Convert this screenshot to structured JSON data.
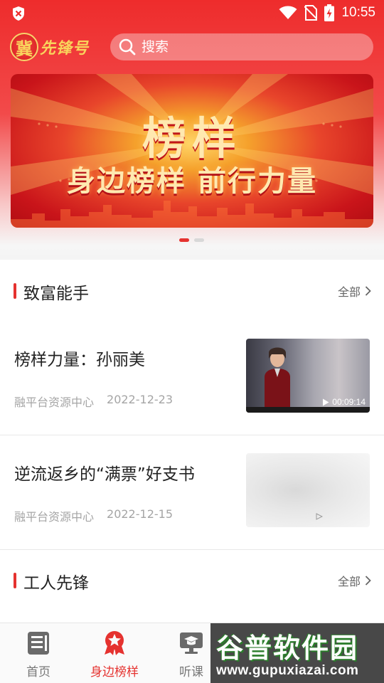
{
  "status_bar": {
    "time": "10:55",
    "icons": [
      "shield-icon",
      "wifi-icon",
      "no-sim-icon",
      "battery-charging-icon"
    ]
  },
  "header": {
    "logo_char": "冀",
    "logo_text": "先锋号",
    "search_placeholder": "搜索"
  },
  "banner": {
    "title": "榜样",
    "subtitle": "身边榜样 前行力量",
    "page_count": 2,
    "active_page": 1
  },
  "sections": [
    {
      "title": "致富能手",
      "more_label": "全部",
      "items": [
        {
          "title": "榜样力量：孙丽美",
          "source": "融平台资源中心",
          "date": "2022-12-23",
          "duration": "00:09:14"
        },
        {
          "title": "逆流返乡的“满票”好支书",
          "source": "融平台资源中心",
          "date": "2022-12-15"
        }
      ]
    },
    {
      "title": "工人先锋",
      "more_label": "全部"
    }
  ],
  "bottom_nav": [
    {
      "label": "首页",
      "icon": "document-icon",
      "active": false
    },
    {
      "label": "身边榜样",
      "icon": "star-badge-icon",
      "active": true
    },
    {
      "label": "听课",
      "icon": "monitor-graduation-icon",
      "active": false
    }
  ],
  "watermark": {
    "title": "谷普软件园",
    "url": "www.gupuxiazai.com"
  },
  "colors": {
    "accent": "#e5322f",
    "header_red": "#ee2c2c",
    "logo_gold": "#f9d35c"
  }
}
